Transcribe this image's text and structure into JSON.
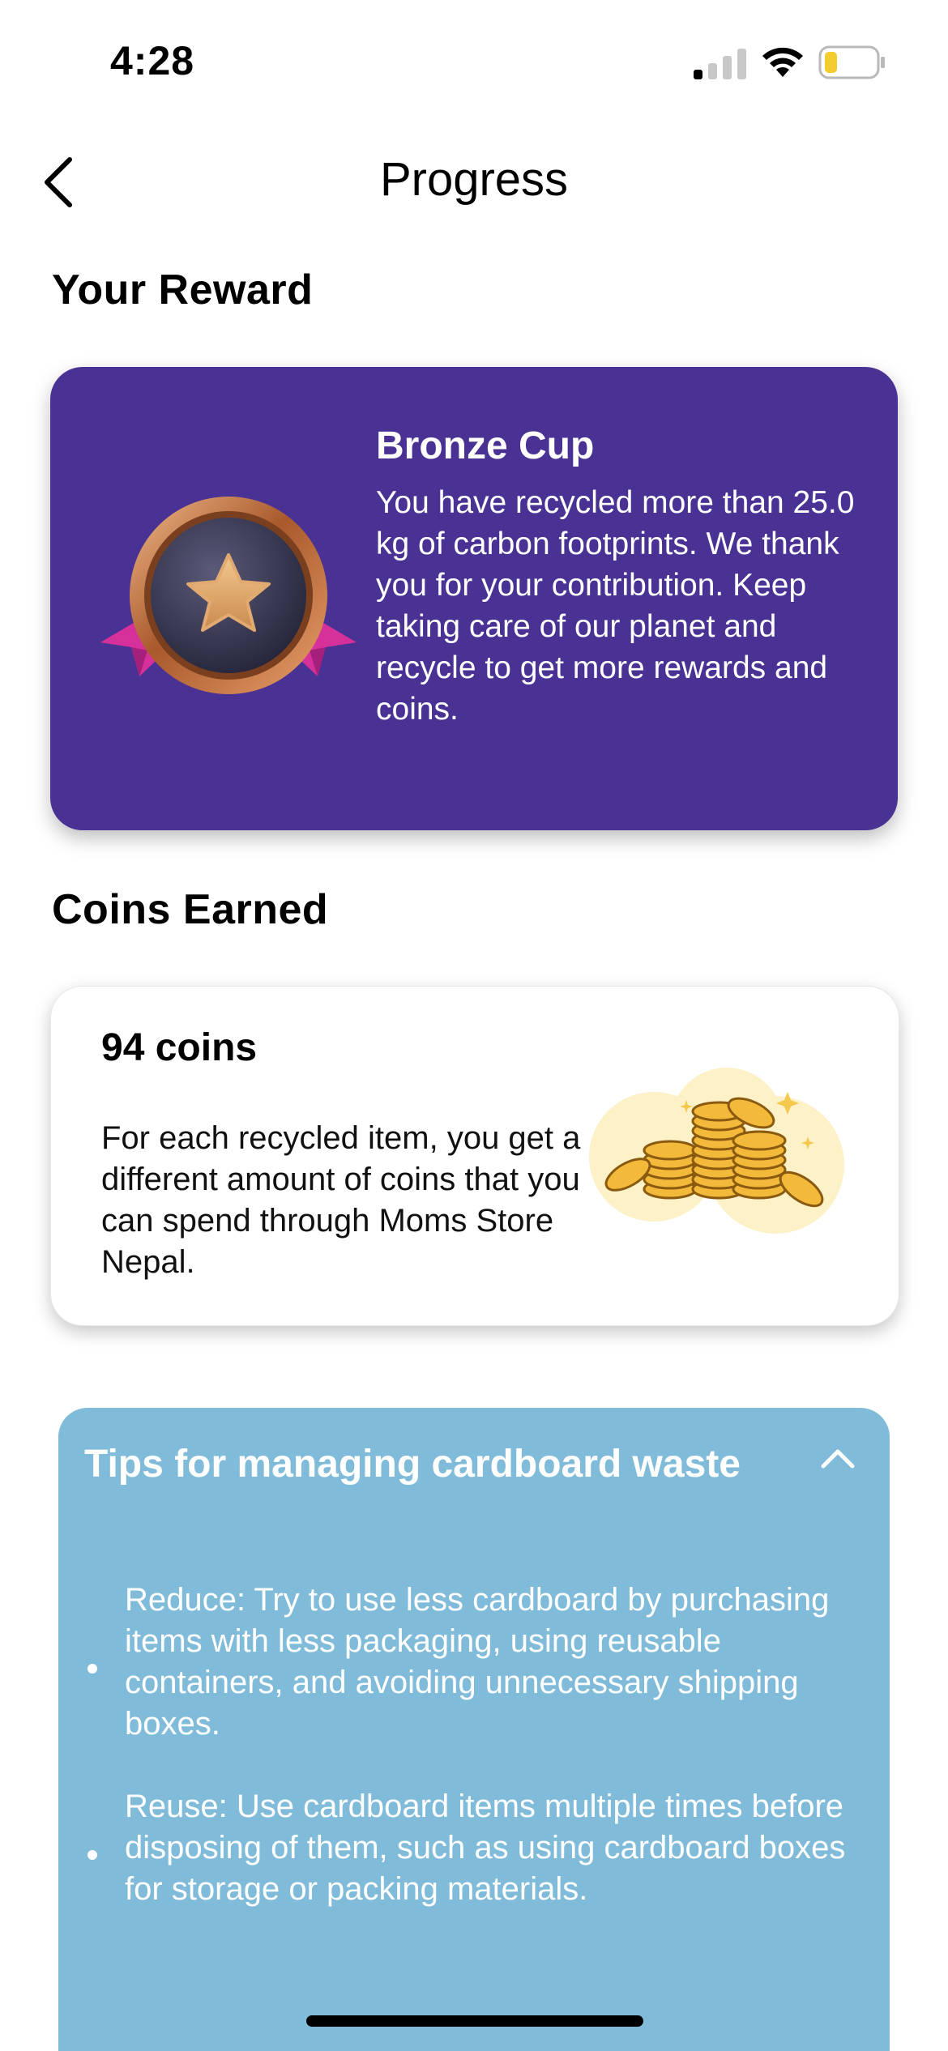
{
  "status_bar": {
    "time": "4:28",
    "signal_bars_active": 1,
    "battery_level": 0.25,
    "battery_color": "#f3cc30"
  },
  "nav": {
    "title": "Progress",
    "back_icon": "chevron-left-icon"
  },
  "reward_section": {
    "title": "Your Reward",
    "card": {
      "background": "#493294",
      "badge_icon": "bronze-medal-icon",
      "title": "Bronze Cup",
      "description": "You have recycled more than 25.0 kg of carbon footprints. We thank you for your contribution. Keep taking care of our planet and recycle to get more rewards and coins."
    }
  },
  "coins_section": {
    "title": "Coins Earned",
    "card": {
      "count_label": "94 coins",
      "description": "For each recycled item, you get a different amount of coins that you can spend through Moms Store Nepal.",
      "illustration_icon": "coin-stack-icon"
    }
  },
  "tips": {
    "title": "Tips for managing cardboard waste",
    "expanded": true,
    "toggle_icon": "chevron-up-icon",
    "background": "#80bcd9",
    "items": [
      "Reduce: Try to use less cardboard by purchasing items with less packaging, using reusable containers, and avoiding unnecessary shipping boxes.",
      "Reuse: Use cardboard items multiple times before disposing of them, such as using cardboard boxes for storage or packing materials."
    ]
  }
}
